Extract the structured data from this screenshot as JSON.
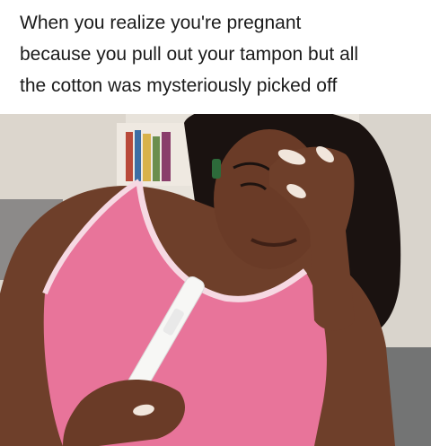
{
  "caption": {
    "lines": [
      "When you realize you're pregnant",
      "because you pull out your tampon but all",
      "the cotton was mysteriously picked off"
    ]
  },
  "photo": {
    "subject": "woman-holding-pregnancy-test",
    "colors": {
      "background": "#e9e4dc",
      "tank_top": "#e8749a",
      "tank_trim": "#f6d9e3",
      "skin": "#6e3f2a",
      "hair": "#1a1210",
      "test_stick": "#f7f7f5",
      "nails": "#f1e6dc"
    }
  }
}
